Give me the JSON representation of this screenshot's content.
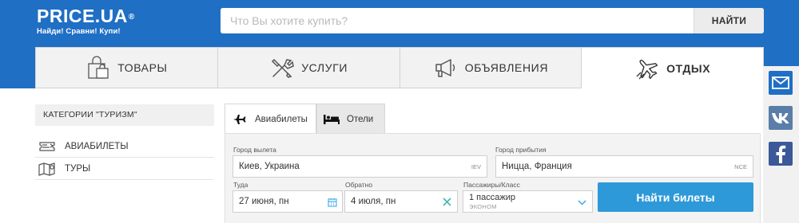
{
  "header": {
    "logo_text": "PRICE.UA",
    "logo_reg": "®",
    "tagline": "Найди! Сравни! Купи!",
    "search_placeholder": "Что Вы хотите купить?",
    "search_button": "НАЙТИ"
  },
  "nav": {
    "tabs": [
      {
        "label": "ТОВАРЫ",
        "icon": "shopping-bag-icon",
        "active": false
      },
      {
        "label": "УСЛУГИ",
        "icon": "tools-icon",
        "active": false
      },
      {
        "label": "ОБЪЯВЛЕНИЯ",
        "icon": "megaphone-icon",
        "active": false
      },
      {
        "label": "ОТДЫХ",
        "icon": "airplane-icon",
        "active": true
      }
    ]
  },
  "categories": {
    "title": "КАТЕГОРИИ \"ТУРИЗМ\"",
    "items": [
      {
        "label": "АВИАБИЛЕТЫ",
        "icon": "ticket-icon"
      },
      {
        "label": "ТУРЫ",
        "icon": "map-icon"
      }
    ]
  },
  "booking": {
    "tabs": [
      {
        "label": "Авиабилеты",
        "icon": "airplane-icon",
        "active": true
      },
      {
        "label": "Отели",
        "icon": "bed-icon",
        "active": false
      }
    ],
    "from_label": "Город вылета",
    "from_value": "Киев, Украина",
    "from_code": "IEV",
    "to_label": "Город прибытия",
    "to_value": "Ницца, Франция",
    "to_code": "NCE",
    "depart_label": "Туда",
    "depart_value": "27 июня, пн",
    "return_label": "Обратно",
    "return_value": "4 июля, пн",
    "passengers_label": "Пассажиры/Класс",
    "passengers_value": "1 пассажир",
    "class_value": "эконом",
    "submit": "Найти билеты"
  },
  "social": [
    "mail-icon",
    "vk-icon",
    "facebook-icon"
  ],
  "colors": {
    "brand_blue": "#1f6fc4",
    "button_blue": "#2e99d8",
    "calendar_icon": "#4ab0e8",
    "clear_icon": "#3fb7b0"
  }
}
